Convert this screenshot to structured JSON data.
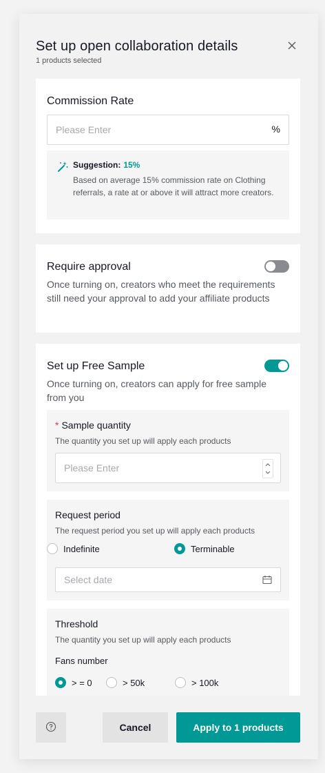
{
  "header": {
    "title": "Set up open collaboration details",
    "subtitle": "1 products selected"
  },
  "commission": {
    "title": "Commission Rate",
    "placeholder": "Please Enter",
    "suffix": "%",
    "suggestion_label": "Suggestion:",
    "suggestion_value": "15%",
    "suggestion_text": "Based on average 15% commission rate on Clothing referrals, a rate at or above it will attract more creators."
  },
  "approval": {
    "title": "Require approval",
    "description": "Once turning on, creators who meet the requirements still need your approval to add your affiliate products",
    "enabled": false
  },
  "free_sample": {
    "title": "Set up Free Sample",
    "description": "Once turning on, creators can apply for free sample from you",
    "enabled": true,
    "quantity": {
      "required_mark": "*",
      "title": "Sample quantity",
      "description": "The quantity you set up will apply each products",
      "placeholder": "Please Enter"
    },
    "request_period": {
      "title": "Request period",
      "description": "The request period you set up will apply each products",
      "options": [
        "Indefinite",
        "Terminable"
      ],
      "selected": "Terminable",
      "date_placeholder": "Select date"
    },
    "threshold": {
      "title": "Threshold",
      "description": "The quantity you set up will apply each products",
      "fans_label": "Fans number",
      "options": [
        "> = 0",
        "> 50k",
        "> 100k"
      ],
      "selected": "> = 0"
    }
  },
  "footer": {
    "cancel_label": "Cancel",
    "apply_label": "Apply to 1 products"
  },
  "colors": {
    "accent": "#009995",
    "toggle_off": "#8a8b91"
  }
}
